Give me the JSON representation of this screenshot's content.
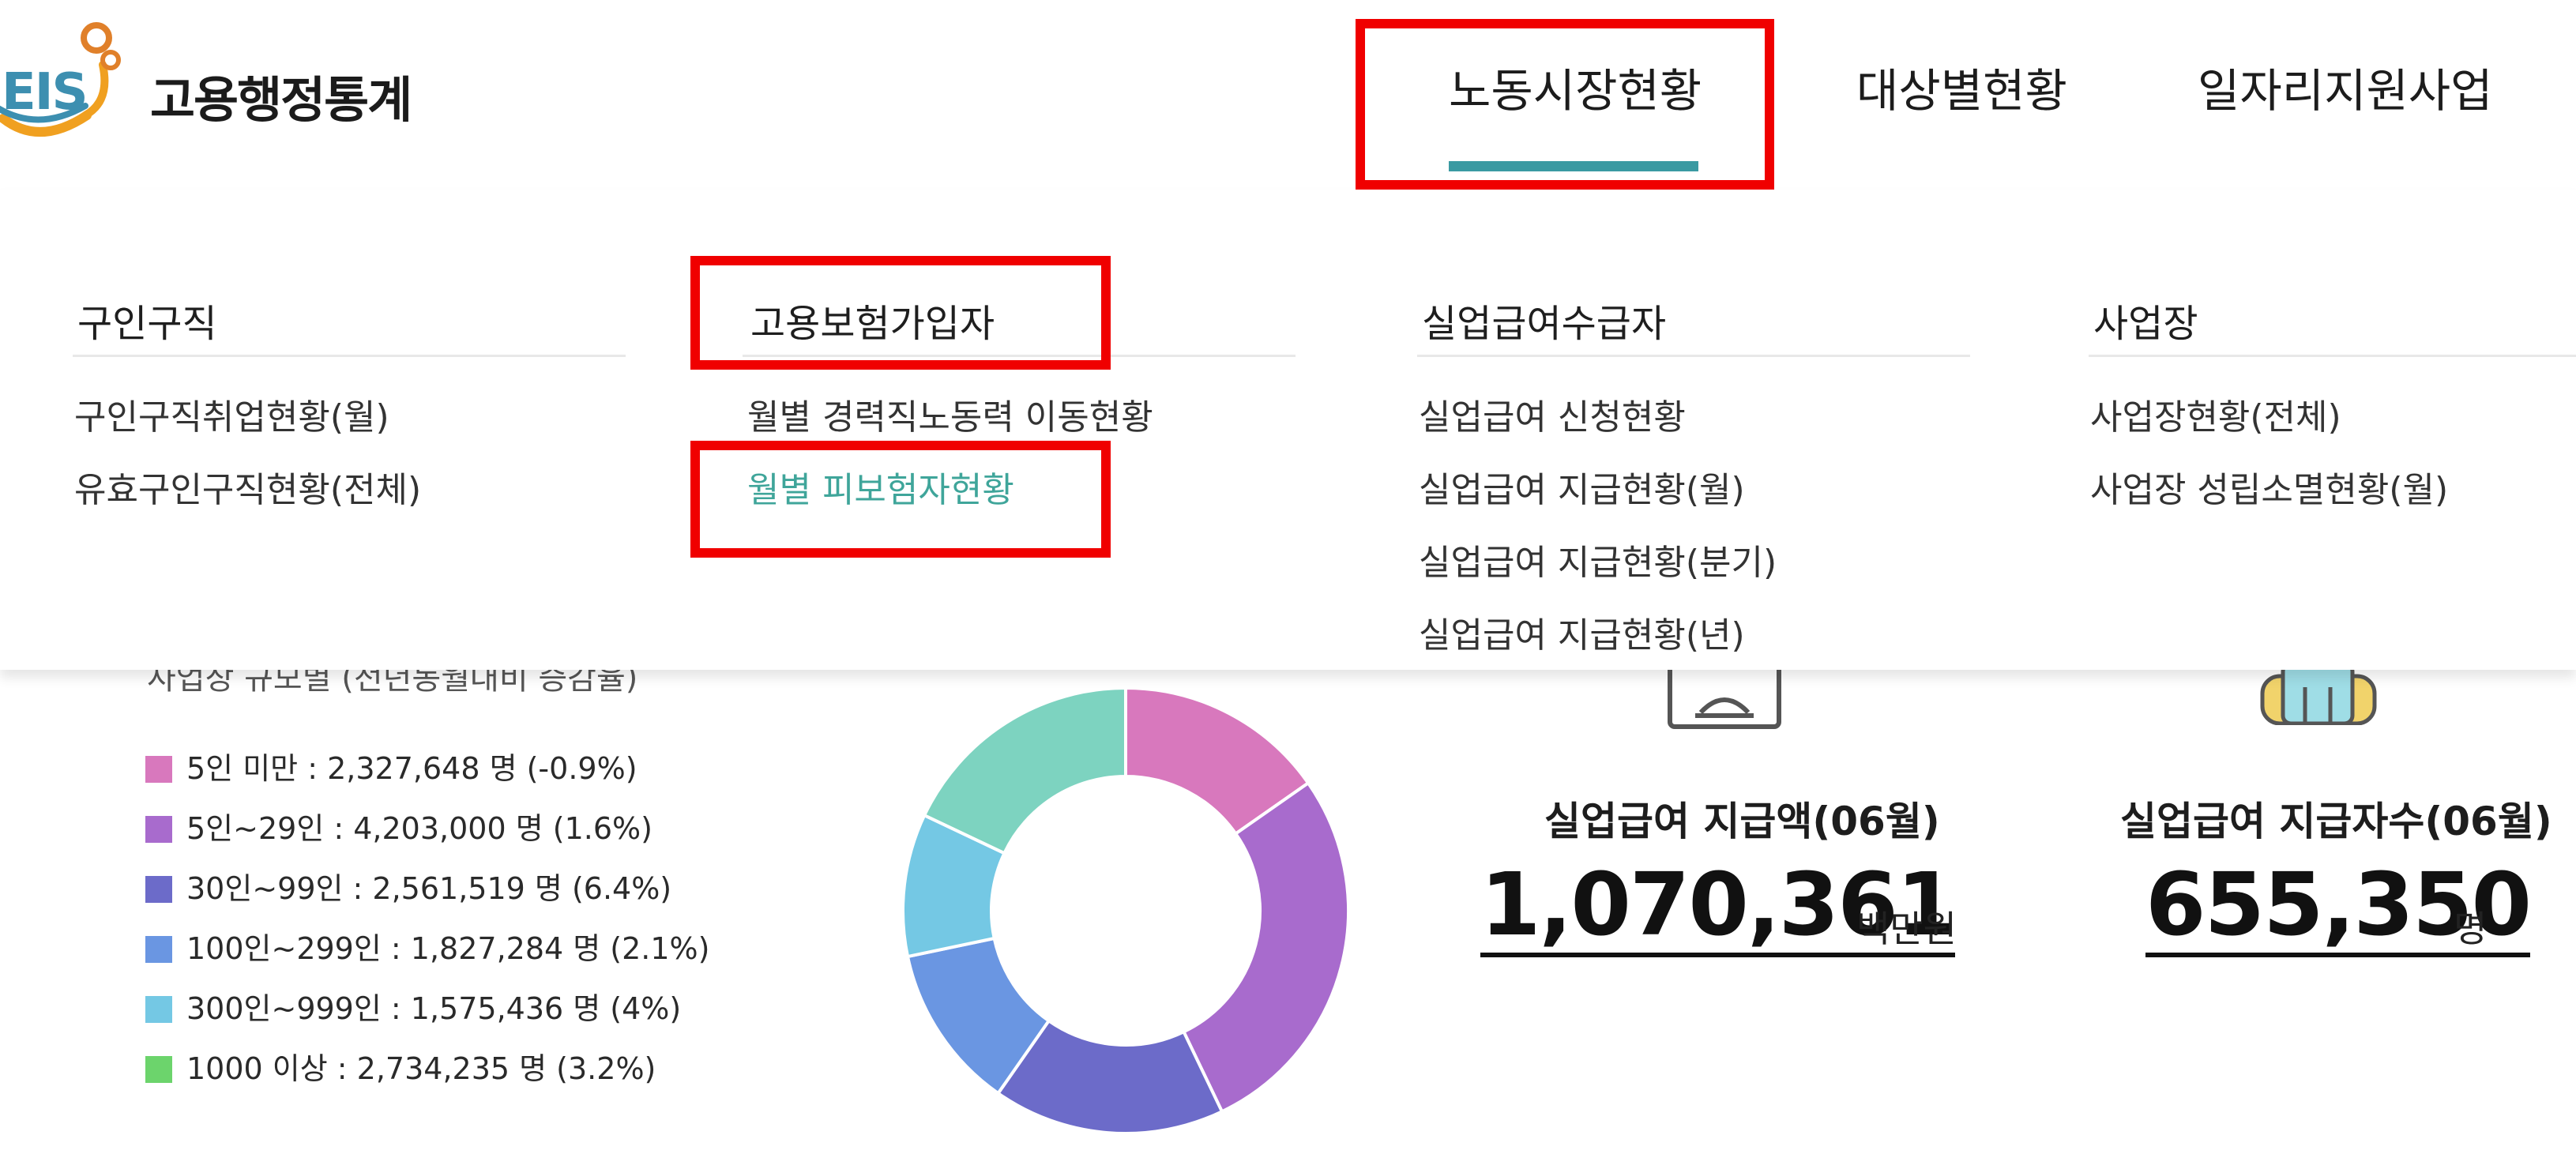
{
  "header": {
    "logo_mark": "EIS",
    "logo_text": "고용행정통계",
    "nav": [
      "노동시장현황",
      "대상별현황",
      "일자리지원사업"
    ]
  },
  "menu": {
    "columns": [
      {
        "title": "구인구직",
        "items": [
          "구인구직취업현황(월)",
          "유효구인구직현황(전체)"
        ]
      },
      {
        "title": "고용보험가입자",
        "items": [
          "월별 경력직노동력 이동현황",
          "월별 피보험자현황"
        ]
      },
      {
        "title": "실업급여수급자",
        "items": [
          "실업급여 신청현황",
          "실업급여 지급현황(월)",
          "실업급여 지급현황(분기)",
          "실업급여 지급현황(년)"
        ]
      },
      {
        "title": "사업장",
        "items": [
          "사업장현황(전체)",
          "사업장 성립소멸현황(월)"
        ]
      }
    ]
  },
  "dashboard": {
    "legend_title": "사업장 규모별 (전년동월대비 증감율)",
    "legend": [
      {
        "label": "5인 미만  : 2,327,648 명 (-0.9%)",
        "color": "#d878bd"
      },
      {
        "label": "5인~29인 : 4,203,000 명 (1.6%)",
        "color": "#a86bcd"
      },
      {
        "label": "30인~99인 : 2,561,519 명 (6.4%)",
        "color": "#6c6bc9"
      },
      {
        "label": "100인~299인 : 1,827,284 명 (2.1%)",
        "color": "#6a96e2"
      },
      {
        "label": "300인~999인 : 1,575,436 명 (4%)",
        "color": "#74c8e4"
      },
      {
        "label": "1000 이상 : 2,734,235 명 (3.2%)",
        "color": "#6cd46c"
      }
    ],
    "stats": [
      {
        "label": "실업급여 지급액(06월)",
        "value": "1,070,361",
        "unit": "백만원"
      },
      {
        "label": "실업급여 지급자수(06월)",
        "value": "655,350",
        "unit": "명"
      }
    ]
  },
  "chart_data": {
    "type": "pie",
    "categories": [
      "5인 미만",
      "5인~29인",
      "30인~99인",
      "100인~299인",
      "300인~999인",
      "1000 이상"
    ],
    "values": [
      2327648,
      4203000,
      2561519,
      1827284,
      1575436,
      2734235
    ],
    "colors": [
      "#d878bd",
      "#a86bcd",
      "#6c6bc9",
      "#6a96e2",
      "#74c8e4",
      "#7dd3c0"
    ]
  },
  "colors": {
    "accent": "#3a9aa2",
    "highlight_box": "#f00000",
    "active_link": "#3fa59a"
  }
}
